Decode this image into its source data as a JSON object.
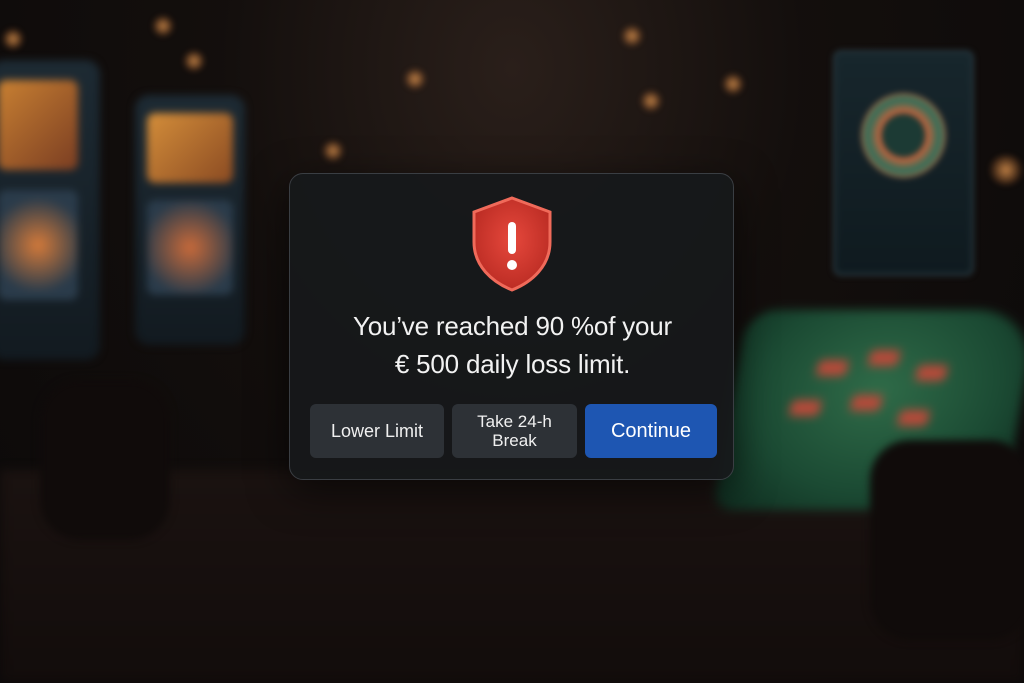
{
  "dialog": {
    "icon": "shield-alert-icon",
    "message_line1": "You’ve reached 90 %of your",
    "message_line2": "€ 500 daily loss limit.",
    "buttons": {
      "lower_limit": "Lower Limit",
      "take_break_line1": "Take 24-h",
      "take_break_line2": "Break",
      "continue": "Continue"
    }
  },
  "colors": {
    "primary_button": "#1e56b2",
    "secondary_button": "#2d3136",
    "alert_icon": "#d8382f",
    "dialog_background": "#16181b"
  }
}
